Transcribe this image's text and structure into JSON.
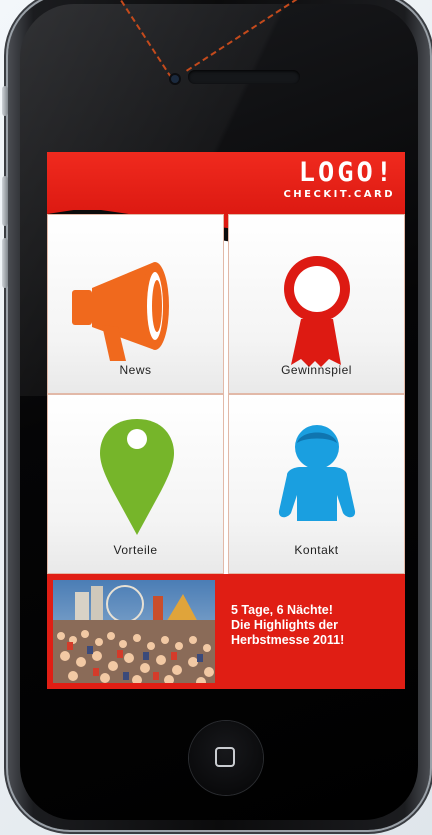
{
  "header": {
    "logo_main": "LOGO!",
    "logo_sub": "CHECKIT.CARD"
  },
  "tiles": [
    {
      "label": "News",
      "icon": "megaphone-icon",
      "color": "#f0691d"
    },
    {
      "label": "Gewinnspiel",
      "icon": "award-ribbon-icon",
      "color": "#dd1a12"
    },
    {
      "label": "Vorteile",
      "icon": "map-pin-icon",
      "color": "#76b52a"
    },
    {
      "label": "Kontakt",
      "icon": "user-contact-icon",
      "color": "#1a9fe0"
    }
  ],
  "banner": {
    "lines": [
      "5 Tage, 6 Nächte!",
      "Die Highlights der",
      "Herbstmesse 2011!"
    ],
    "image": "fair-crowd-photo"
  },
  "colors": {
    "brand_red": "#dd1a12",
    "news_orange": "#f0691d",
    "green": "#76b52a",
    "blue": "#1a9fe0"
  }
}
